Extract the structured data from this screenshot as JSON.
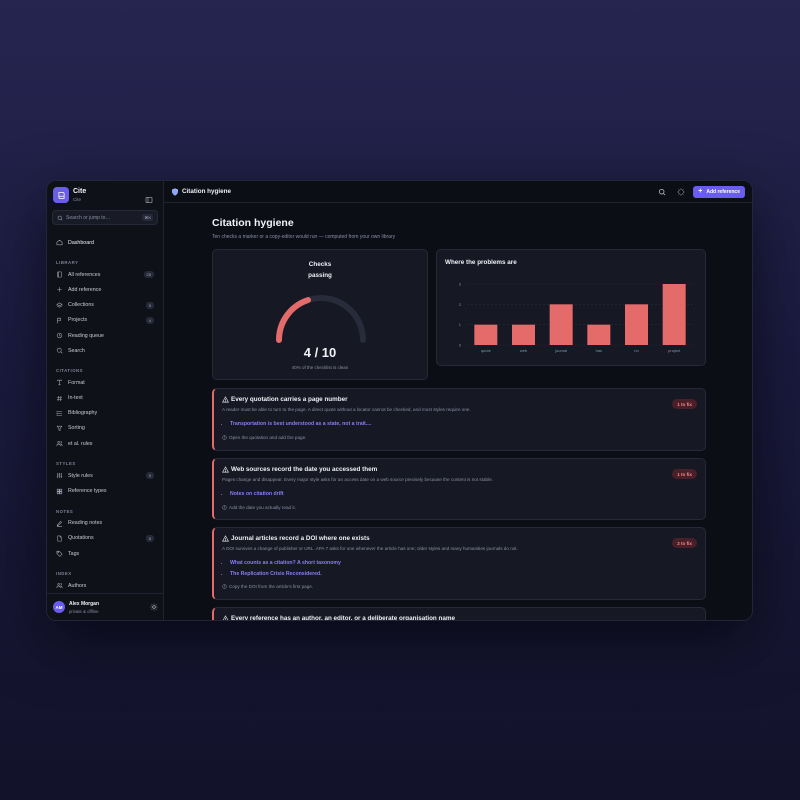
{
  "brand": {
    "name": "Cite",
    "sub": "Cite"
  },
  "search": {
    "placeholder": "Search or jump to…",
    "shortcut": "⌘K"
  },
  "sidebar": {
    "top": [
      {
        "label": "Dashboard",
        "icon": "home-icon"
      }
    ],
    "sections": [
      {
        "title": "LIBRARY",
        "items": [
          {
            "label": "All references",
            "icon": "book-icon",
            "count": "28"
          },
          {
            "label": "Add reference",
            "icon": "plus-icon",
            "count": ""
          },
          {
            "label": "Collections",
            "icon": "layers-icon",
            "count": "5"
          },
          {
            "label": "Projects",
            "icon": "flag-icon",
            "count": "4"
          },
          {
            "label": "Reading queue",
            "icon": "clock-icon",
            "count": ""
          },
          {
            "label": "Search",
            "icon": "search-icon",
            "count": ""
          }
        ]
      },
      {
        "title": "CITATIONS",
        "items": [
          {
            "label": "Format",
            "icon": "type-icon",
            "count": ""
          },
          {
            "label": "In-text",
            "icon": "hash-icon",
            "count": ""
          },
          {
            "label": "Bibliography",
            "icon": "list-icon",
            "count": ""
          },
          {
            "label": "Sorting",
            "icon": "filter-icon",
            "count": ""
          },
          {
            "label": "et al. rules",
            "icon": "users-icon",
            "count": ""
          }
        ]
      },
      {
        "title": "STYLES",
        "items": [
          {
            "label": "Style rules",
            "icon": "sliders-icon",
            "count": "5"
          },
          {
            "label": "Reference types",
            "icon": "grid-icon",
            "count": ""
          }
        ]
      },
      {
        "title": "NOTES",
        "items": [
          {
            "label": "Reading notes",
            "icon": "pen-icon",
            "count": ""
          },
          {
            "label": "Quotations",
            "icon": "file-icon",
            "count": "8"
          },
          {
            "label": "Tags",
            "icon": "tag-icon",
            "count": ""
          }
        ]
      },
      {
        "title": "INDEX",
        "items": [
          {
            "label": "Authors",
            "icon": "users-icon",
            "count": ""
          }
        ]
      }
    ]
  },
  "user": {
    "initials": "AM",
    "name": "Alex Morgan",
    "status": "private & offline"
  },
  "topbar": {
    "title": "Citation hygiene",
    "add_label": "Add reference"
  },
  "page": {
    "title": "Citation hygiene",
    "subtitle": "Ten checks a marker or a copy-editor would run — computed from your own library"
  },
  "gauge": {
    "label_line1": "Checks",
    "label_line2": "passing",
    "value": "4 / 10",
    "fraction": 0.4,
    "caption": "40% of the checklist is clean"
  },
  "chart_data": {
    "type": "bar",
    "title": "Where the problems are",
    "categories": [
      "quote",
      "web",
      "journal",
      "has",
      "no",
      "project"
    ],
    "values": [
      1,
      1,
      2,
      1,
      2,
      3
    ],
    "ylim": [
      0,
      3
    ],
    "yticks": [
      "0",
      "1",
      "2",
      "3"
    ],
    "grid": true,
    "bar_color": "#e56a6a"
  },
  "checks": [
    {
      "title": "Every quotation carries a page number",
      "desc": "A reader must be able to turn to the page. A direct quote without a locator cannot be checked, and most styles require one.",
      "fix": "1 to fix",
      "links": [
        "Transportation is best understood as a state, not a trait...."
      ],
      "hint": "Open the quotation and add the page."
    },
    {
      "title": "Web sources record the date you accessed them",
      "desc": "Pages change and disappear. Every major style asks for an access date on a web source precisely because the content is not stable.",
      "fix": "1 to fix",
      "links": [
        "Notes on citation drift"
      ],
      "hint": "Add the date you actually read it."
    },
    {
      "title": "Journal articles record a DOI where one exists",
      "desc": "A DOI survives a change of publisher or URL. APA 7 asks for one whenever the article has one; older styles and many humanities journals do not.",
      "fix": "2 to fix",
      "links": [
        "What counts as a citation? A short taxonomy",
        "The Replication Crisis Reconsidered."
      ],
      "hint": "Copy the DOI from the article's first page."
    },
    {
      "title": "Every reference has an author, an editor, or a deliberate organisation name",
      "desc": "",
      "fix": "",
      "links": [],
      "hint": ""
    }
  ],
  "colors": {
    "accent": "#6b5cf0",
    "danger": "#e56a6a",
    "bg": "#0c0e15",
    "card": "#161923"
  }
}
